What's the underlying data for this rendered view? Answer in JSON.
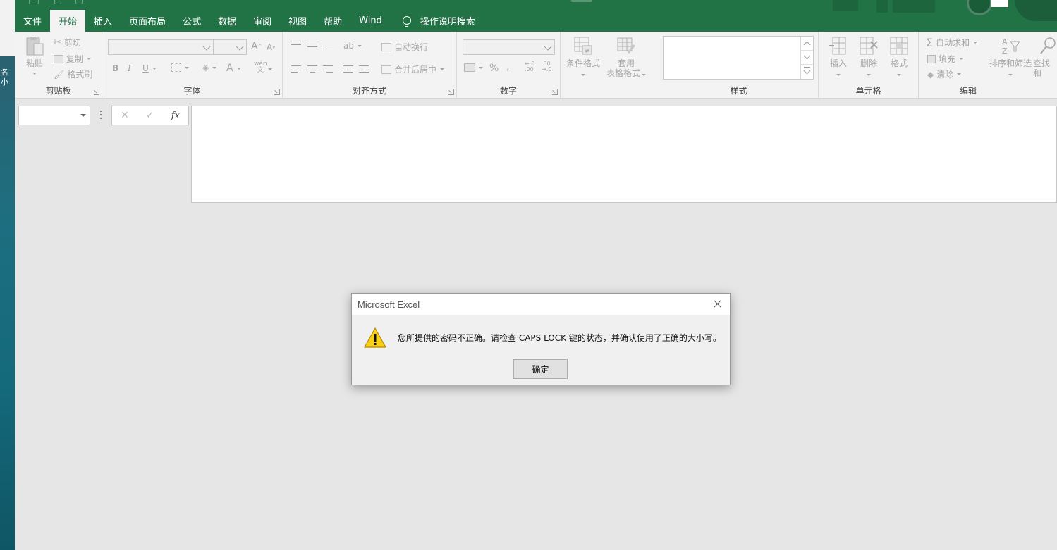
{
  "desktop": {
    "side_label": "名\n小"
  },
  "tabs": [
    {
      "label": "文件"
    },
    {
      "label": "开始"
    },
    {
      "label": "插入"
    },
    {
      "label": "页面布局"
    },
    {
      "label": "公式"
    },
    {
      "label": "数据"
    },
    {
      "label": "审阅"
    },
    {
      "label": "视图"
    },
    {
      "label": "帮助"
    },
    {
      "label": "Wind"
    }
  ],
  "tell_me": "操作说明搜索",
  "ribbon": {
    "clipboard": {
      "label": "剪贴板",
      "paste": "粘贴",
      "cut": "剪切",
      "copy": "复制",
      "format_painter": "格式刷"
    },
    "font": {
      "label": "字体",
      "bold": "B",
      "italic": "I",
      "underline": "U",
      "grow": "A",
      "shrink": "A",
      "font_color": "A",
      "phonetic_top": "wén",
      "phonetic_bottom": "文"
    },
    "alignment": {
      "label": "对齐方式",
      "wrap_text": "自动换行",
      "merge_center": "合并后居中"
    },
    "number": {
      "label": "数字",
      "percent": "%",
      "comma": ",",
      "inc_decimal": "←.0\n.00",
      "dec_decimal": ".00\n→.0"
    },
    "styles": {
      "label": "样式",
      "conditional": "条件格式",
      "format_table_1": "套用",
      "format_table_2": "表格格式"
    },
    "cells": {
      "label": "单元格",
      "insert": "插入",
      "delete": "删除",
      "format": "格式"
    },
    "editing": {
      "label": "编辑",
      "autosum": "自动求和",
      "fill": "填充",
      "clear": "清除",
      "sort_filter": "排序和筛选",
      "find_select": "查找和"
    }
  },
  "formula_bar": {
    "fx": "fx",
    "cancel": "✕",
    "enter": "✓"
  },
  "dialog": {
    "title": "Microsoft Excel",
    "message": "您所提供的密码不正确。请检查 CAPS LOCK 键的状态，并确认使用了正确的大小写。",
    "ok": "确定"
  },
  "colors": {
    "accent": "#217346",
    "warning": "#f7d117"
  }
}
